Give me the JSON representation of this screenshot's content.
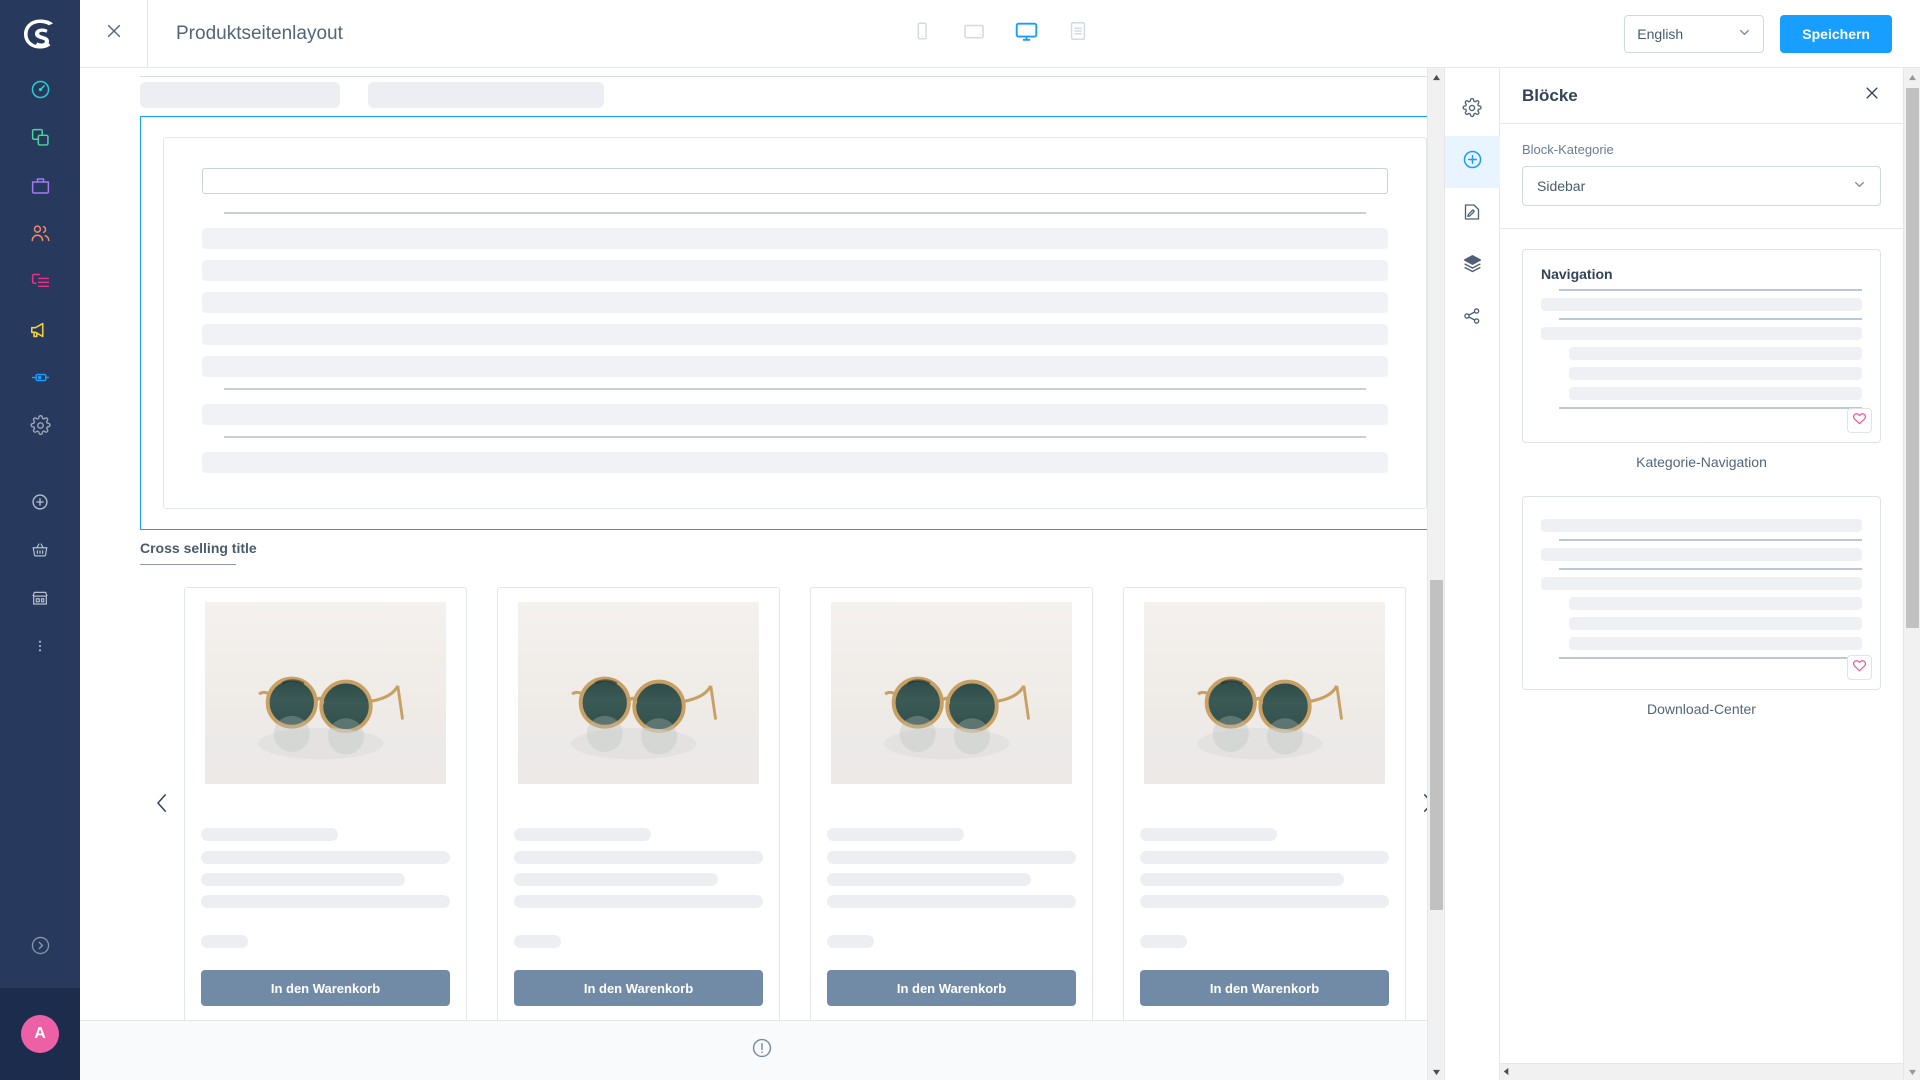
{
  "app": {
    "brand_logo": "shopware-logo-icon",
    "accent_blue": "#189eff",
    "rail_bg": "#273a5e",
    "avatar_color": "#ed60a5"
  },
  "rail": {
    "items": [
      {
        "icon": "dashboard-gauge-icon",
        "color": "#26d0ce",
        "name": "dashboard"
      },
      {
        "icon": "catalogues-copy-icon",
        "color": "#4dd599",
        "name": "catalogues"
      },
      {
        "icon": "orders-briefcase-icon",
        "color": "#a479f3",
        "name": "orders"
      },
      {
        "icon": "customers-people-icon",
        "color": "#f88962",
        "name": "customers"
      },
      {
        "icon": "content-page-icon",
        "color": "#ee2f88",
        "name": "content"
      },
      {
        "icon": "marketing-megaphone-icon",
        "color": "#f5d03a",
        "name": "marketing"
      },
      {
        "icon": "extensions-plug-icon",
        "color": "#189eff",
        "name": "extensions"
      },
      {
        "icon": "settings-gear-icon",
        "color": "#9aa8b8",
        "name": "settings"
      }
    ],
    "actions": [
      {
        "icon": "add-circle-icon",
        "name": "quick-add"
      },
      {
        "icon": "basket-icon",
        "name": "orders-shortcut"
      },
      {
        "icon": "storefront-icon",
        "name": "storefront-shortcut"
      },
      {
        "icon": "more-vertical-icon",
        "name": "more-actions"
      }
    ],
    "collapse_icon": "chevron-right-circle-icon",
    "avatar_initial": "A"
  },
  "topbar": {
    "close_icon": "close-icon",
    "title": "Produktseitenlayout",
    "devices": [
      {
        "name": "mobile",
        "icon": "mobile-icon",
        "active": false
      },
      {
        "name": "tablet",
        "icon": "tablet-icon",
        "active": false
      },
      {
        "name": "desktop",
        "icon": "desktop-icon",
        "active": true
      },
      {
        "name": "form",
        "icon": "form-list-icon",
        "active": false
      }
    ],
    "language": "English",
    "language_chevron": "chevron-down-icon",
    "save_label": "Speichern"
  },
  "canvas": {
    "selected_block": {
      "type": "product-description-skeleton",
      "has_input": true,
      "bars": 8,
      "dividers": 3
    },
    "cross_selling": {
      "title": "Cross selling title",
      "prev_icon": "chevron-left-icon",
      "next_icon": "chevron-right-icon",
      "cart_button_label": "In den Warenkorb",
      "cart_button_color": "#718ba6",
      "products": [
        {
          "image": "sunglasses-product-image"
        },
        {
          "image": "sunglasses-product-image"
        },
        {
          "image": "sunglasses-product-image"
        },
        {
          "image": "sunglasses-product-image"
        }
      ]
    },
    "footer_icon": "info-circle-icon",
    "scrollbar": {
      "up_icon": "triangle-up-icon",
      "down_icon": "triangle-down-icon"
    }
  },
  "right_panel": {
    "tools": [
      {
        "name": "settings",
        "icon": "gear-icon",
        "active": false
      },
      {
        "name": "blocks",
        "icon": "plus-circle-icon",
        "active": true
      },
      {
        "name": "elements",
        "icon": "edit-document-icon",
        "active": false
      },
      {
        "name": "layers",
        "icon": "layers-icon",
        "active": false
      },
      {
        "name": "share",
        "icon": "share-nodes-icon",
        "active": false
      }
    ],
    "panel_title": "Blöcke",
    "close_icon": "close-icon",
    "category_label": "Block-Kategorie",
    "category_value": "Sidebar",
    "category_chevron": "chevron-down-icon",
    "blocks": [
      {
        "name": "Kategorie-Navigation",
        "preview_heading": "Navigation",
        "favorite_icon": "heart-icon",
        "favorite_color": "#ee2f88"
      },
      {
        "name": "Download-Center",
        "preview_heading": "",
        "favorite_icon": "heart-icon",
        "favorite_color": "#ee2f88"
      }
    ],
    "scrollbar": {
      "up_icon": "triangle-up-icon",
      "down_icon": "triangle-down-icon"
    }
  }
}
